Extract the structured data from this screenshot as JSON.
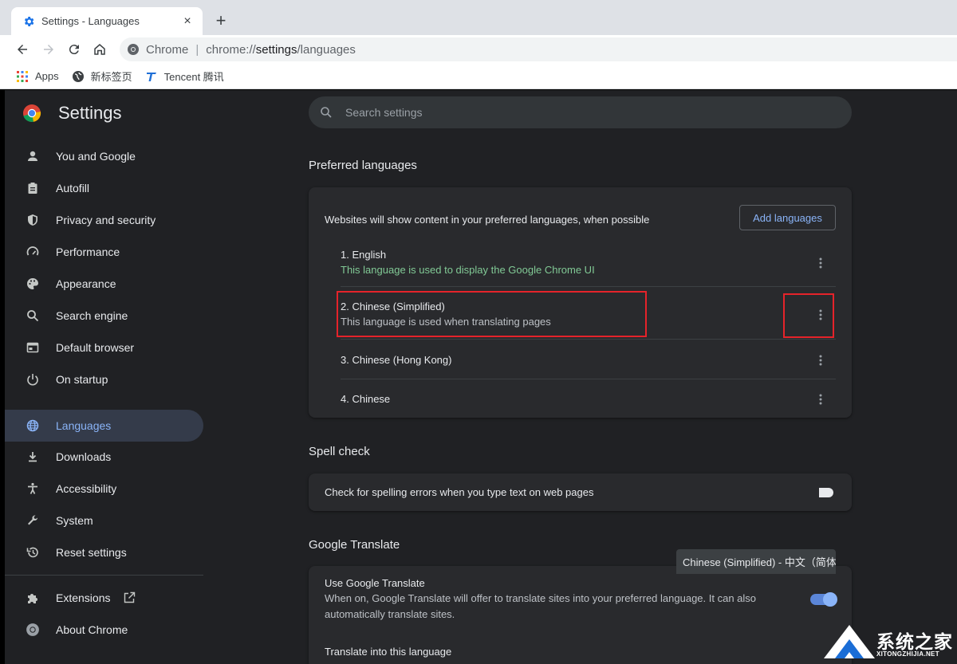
{
  "browser": {
    "tab_title": "Settings - Languages",
    "tab_close": "×",
    "new_tab": "+",
    "omnibox": {
      "chip": "Chrome",
      "separator": "|",
      "url_scheme": "chrome://",
      "url_host": "settings",
      "url_path": "/languages"
    },
    "bookmarks": [
      {
        "label": "Apps",
        "icon": "apps-grid-icon"
      },
      {
        "label": "新标签页",
        "icon": "globe-icon"
      },
      {
        "label": "Tencent 腾讯",
        "icon": "tencent-logo-icon"
      }
    ]
  },
  "settings": {
    "title": "Settings",
    "search_placeholder": "Search settings",
    "nav": [
      {
        "label": "You and Google",
        "icon": "person-icon"
      },
      {
        "label": "Autofill",
        "icon": "clipboard-icon"
      },
      {
        "label": "Privacy and security",
        "icon": "shield-icon"
      },
      {
        "label": "Performance",
        "icon": "speedometer-icon"
      },
      {
        "label": "Appearance",
        "icon": "palette-icon"
      },
      {
        "label": "Search engine",
        "icon": "search-icon"
      },
      {
        "label": "Default browser",
        "icon": "browser-window-icon"
      },
      {
        "label": "On startup",
        "icon": "power-icon"
      },
      {
        "label": "Languages",
        "icon": "globe-icon",
        "active": true
      },
      {
        "label": "Downloads",
        "icon": "download-icon"
      },
      {
        "label": "Accessibility",
        "icon": "accessibility-icon"
      },
      {
        "label": "System",
        "icon": "wrench-icon"
      },
      {
        "label": "Reset settings",
        "icon": "history-icon"
      },
      {
        "label": "Extensions",
        "icon": "puzzle-icon"
      },
      {
        "label": "About Chrome",
        "icon": "chrome-logo-icon"
      }
    ]
  },
  "languages": {
    "section_title": "Preferred languages",
    "description": "Websites will show content in your preferred languages, when possible",
    "add_button": "Add languages",
    "items": [
      {
        "name": "1. English",
        "note": "This language is used to display the Google Chrome UI"
      },
      {
        "name": "2. Chinese (Simplified)",
        "note": "This language is used when translating pages"
      },
      {
        "name": "3. Chinese (Hong Kong)",
        "note": ""
      },
      {
        "name": "4. Chinese",
        "note": ""
      }
    ]
  },
  "spell_check": {
    "section_title": "Spell check",
    "label": "Check for spelling errors when you type text on web pages",
    "enabled": false
  },
  "translate": {
    "section_title": "Google Translate",
    "use_title": "Use Google Translate",
    "use_desc": "When on, Google Translate will offer to translate sites into your preferred language. It can also automatically translate sites.",
    "enabled": true,
    "target_label": "Translate into this language",
    "target_value": "Chinese (Simplified) - 中文（简体）"
  },
  "watermark": {
    "text": "系统之家",
    "url": "XITONGZHIJIA.NET"
  },
  "colors": {
    "accent": "#8ab4f8",
    "highlight_box": "#e5232a",
    "ui_language_note": "#81c995"
  }
}
